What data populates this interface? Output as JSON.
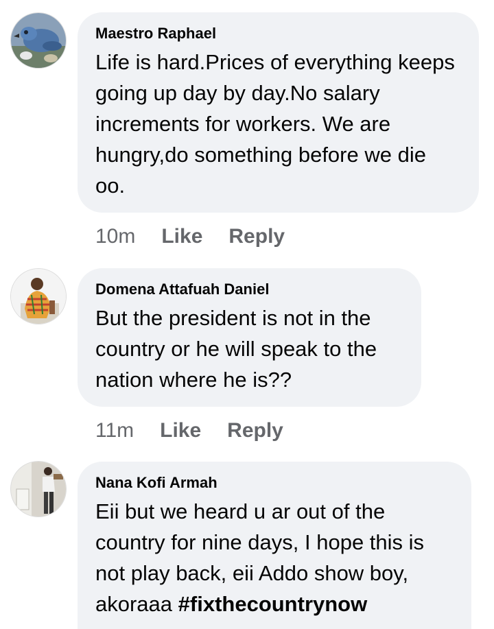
{
  "comments": [
    {
      "author": "Maestro Raphael",
      "text": "Life is hard.Prices of everything keeps going up day by day.No salary increments for workers. We are hungry,do something before we die oo.",
      "time": "10m",
      "like_label": "Like",
      "reply_label": "Reply"
    },
    {
      "author": "Domena Attafuah Daniel",
      "text": "But the president is not in the country or he will speak to the nation where he is??",
      "time": "11m",
      "like_label": "Like",
      "reply_label": "Reply"
    },
    {
      "author": "Nana Kofi Armah",
      "text": "Eii but we heard u ar out of the country for nine days, I hope this is not play back, eii Addo show boy, akoraaa",
      "hashtag": "#fixthecountrynow"
    }
  ],
  "colors": {
    "bubble_bg": "#f0f2f5",
    "text": "#050505",
    "meta": "#65676b"
  },
  "icons": [
    "avatar-parrot-photo",
    "avatar-man-kente-photo",
    "avatar-man-standing-photo"
  ]
}
